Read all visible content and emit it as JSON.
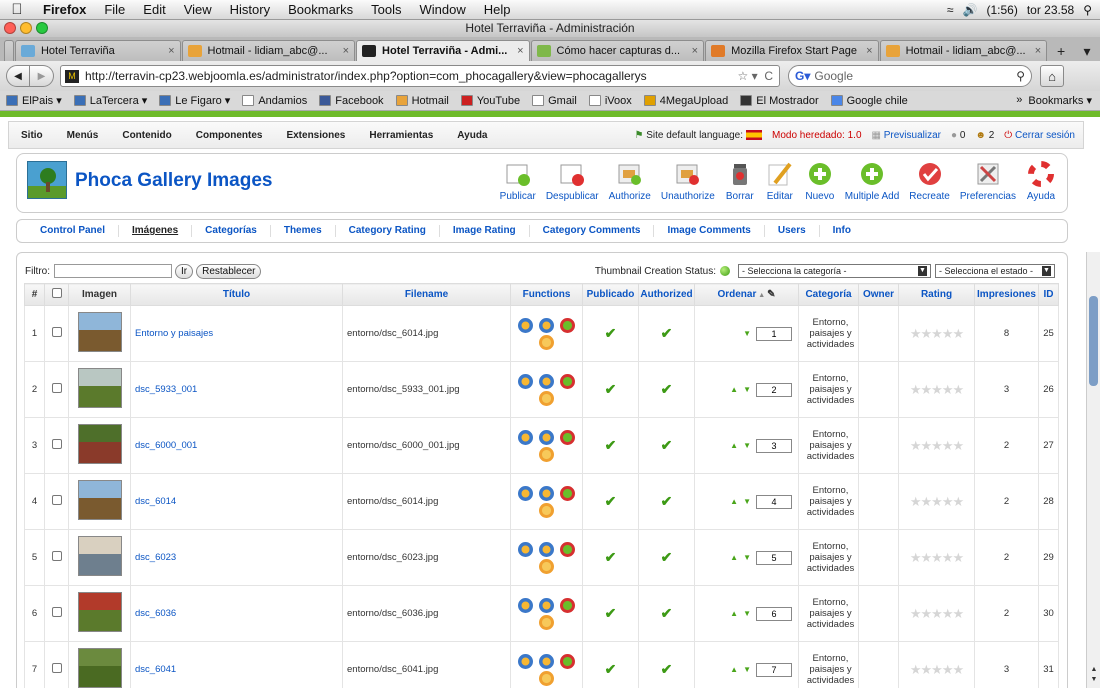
{
  "mac_menu": {
    "app": "Firefox",
    "items": [
      "File",
      "Edit",
      "View",
      "History",
      "Bookmarks",
      "Tools",
      "Window",
      "Help"
    ],
    "battery": "(1:56)",
    "clock": "tor 23.58"
  },
  "window": {
    "title": "Hotel Terraviña - Administración"
  },
  "tabs": [
    {
      "label": "Hotel Terraviña",
      "color": "#6aaad8",
      "active": false
    },
    {
      "label": "Hotmail - lidiam_abc@...",
      "color": "#e8a33a",
      "active": false
    },
    {
      "label": "Hotel Terraviña - Admi...",
      "color": "#222222",
      "active": true
    },
    {
      "label": "Cómo hacer capturas d...",
      "color": "#7fb84a",
      "active": false
    },
    {
      "label": "Mozilla Firefox Start Page",
      "color": "#e07a28",
      "active": false
    },
    {
      "label": "Hotmail - lidiam_abc@...",
      "color": "#e8a33a",
      "active": false
    }
  ],
  "nav": {
    "url": "http://terravin-cp23.webjoomla.es/administrator/index.php?option=com_phocagallery&view=phocagallerys",
    "search_placeholder": "Google"
  },
  "bookmarks": [
    {
      "label": "ElPais ▾",
      "color": "#3b6fb6"
    },
    {
      "label": "LaTercera ▾",
      "color": "#3b6fb6"
    },
    {
      "label": "Le Figaro ▾",
      "color": "#3b6fb6"
    },
    {
      "label": "Andamios",
      "color": "#ffffff"
    },
    {
      "label": "Facebook",
      "color": "#3b5998"
    },
    {
      "label": "Hotmail",
      "color": "#e8a33a"
    },
    {
      "label": "YouTube",
      "color": "#cc2020"
    },
    {
      "label": "Gmail",
      "color": "#ffffff"
    },
    {
      "label": "iVoox",
      "color": "#ffffff"
    },
    {
      "label": "4MegaUpload",
      "color": "#e0a000"
    },
    {
      "label": "El Mostrador",
      "color": "#333333"
    },
    {
      "label": "Google chile",
      "color": "#4a86e8"
    }
  ],
  "bookmarks_right": {
    "more": "»",
    "label": "Bookmarks ▾"
  },
  "admin_menu": {
    "items": [
      "Sitio",
      "Menús",
      "Contenido",
      "Componentes",
      "Extensiones",
      "Herramientas",
      "Ayuda"
    ],
    "language": "Site default language:",
    "legacy": "Modo heredado: 1.0",
    "preview": "Previsualizar",
    "msgs": "0",
    "users": "2",
    "logout": "Cerrar sesión"
  },
  "page": {
    "title": "Phoca Gallery Images"
  },
  "toolbar": [
    {
      "label": "Publicar",
      "icon": "publish-icon"
    },
    {
      "label": "Despublicar",
      "icon": "unpublish-icon"
    },
    {
      "label": "Authorize",
      "icon": "authorize-icon"
    },
    {
      "label": "Unauthorize",
      "icon": "unauthorize-icon"
    },
    {
      "label": "Borrar",
      "icon": "trash-icon"
    },
    {
      "label": "Editar",
      "icon": "edit-pencil-icon"
    },
    {
      "label": "Nuevo",
      "icon": "new-plus-icon"
    },
    {
      "label": "Multiple Add",
      "icon": "multiple-add-icon"
    },
    {
      "label": "Recreate",
      "icon": "recreate-icon"
    },
    {
      "label": "Preferencias",
      "icon": "preferences-icon"
    },
    {
      "label": "Ayuda",
      "icon": "help-lifebuoy-icon"
    }
  ],
  "submenu": [
    "Control Panel",
    "Imágenes",
    "Categorías",
    "Themes",
    "Category Rating",
    "Image Rating",
    "Category Comments",
    "Image Comments",
    "Users",
    "Info"
  ],
  "submenu_active": "Imágenes",
  "filter": {
    "label": "Filtro:",
    "go": "Ir",
    "reset": "Restablecer",
    "thumb_status": "Thumbnail Creation Status:",
    "category_select": "- Selecciona la categoría -",
    "state_select": "- Selecciona el estado -"
  },
  "table": {
    "headers": [
      "#",
      "",
      "Imagen",
      "Título",
      "Filename",
      "Functions",
      "Publicado",
      "Authorized",
      "Ordenar",
      "Categoría",
      "Owner",
      "Rating",
      "Impresiones",
      "ID"
    ],
    "rows": [
      {
        "num": "1",
        "title": "Entorno y paisajes",
        "filename": "entorno/dsc_6014.jpg",
        "order": "1",
        "category": "Entorno, paisajes y actividades",
        "hits": "8",
        "id": "25",
        "up": false,
        "sky": "#8fb6d9",
        "land": "#7a5a2f"
      },
      {
        "num": "2",
        "title": "dsc_5933_001",
        "filename": "entorno/dsc_5933_001.jpg",
        "order": "2",
        "category": "Entorno, paisajes y actividades",
        "hits": "3",
        "id": "26",
        "up": true,
        "sky": "#b9c7c2",
        "land": "#5b7a2c"
      },
      {
        "num": "3",
        "title": "dsc_6000_001",
        "filename": "entorno/dsc_6000_001.jpg",
        "order": "3",
        "category": "Entorno, paisajes y actividades",
        "hits": "2",
        "id": "27",
        "up": true,
        "sky": "#4e6f2a",
        "land": "#8a3a2a"
      },
      {
        "num": "4",
        "title": "dsc_6014",
        "filename": "entorno/dsc_6014.jpg",
        "order": "4",
        "category": "Entorno, paisajes y actividades",
        "hits": "2",
        "id": "28",
        "up": true,
        "sky": "#8fb6d9",
        "land": "#7a5a2f"
      },
      {
        "num": "5",
        "title": "dsc_6023",
        "filename": "entorno/dsc_6023.jpg",
        "order": "5",
        "category": "Entorno, paisajes y actividades",
        "hits": "2",
        "id": "29",
        "up": true,
        "sky": "#d9d0c0",
        "land": "#6e7f8e"
      },
      {
        "num": "6",
        "title": "dsc_6036",
        "filename": "entorno/dsc_6036.jpg",
        "order": "6",
        "category": "Entorno, paisajes y actividades",
        "hits": "2",
        "id": "30",
        "up": true,
        "sky": "#b23a2a",
        "land": "#5b7a2c"
      },
      {
        "num": "7",
        "title": "dsc_6041",
        "filename": "entorno/dsc_6041.jpg",
        "order": "7",
        "category": "Entorno, paisajes y actividades",
        "hits": "3",
        "id": "31",
        "up": true,
        "sky": "#6b8a3e",
        "land": "#4a6a22"
      }
    ]
  }
}
